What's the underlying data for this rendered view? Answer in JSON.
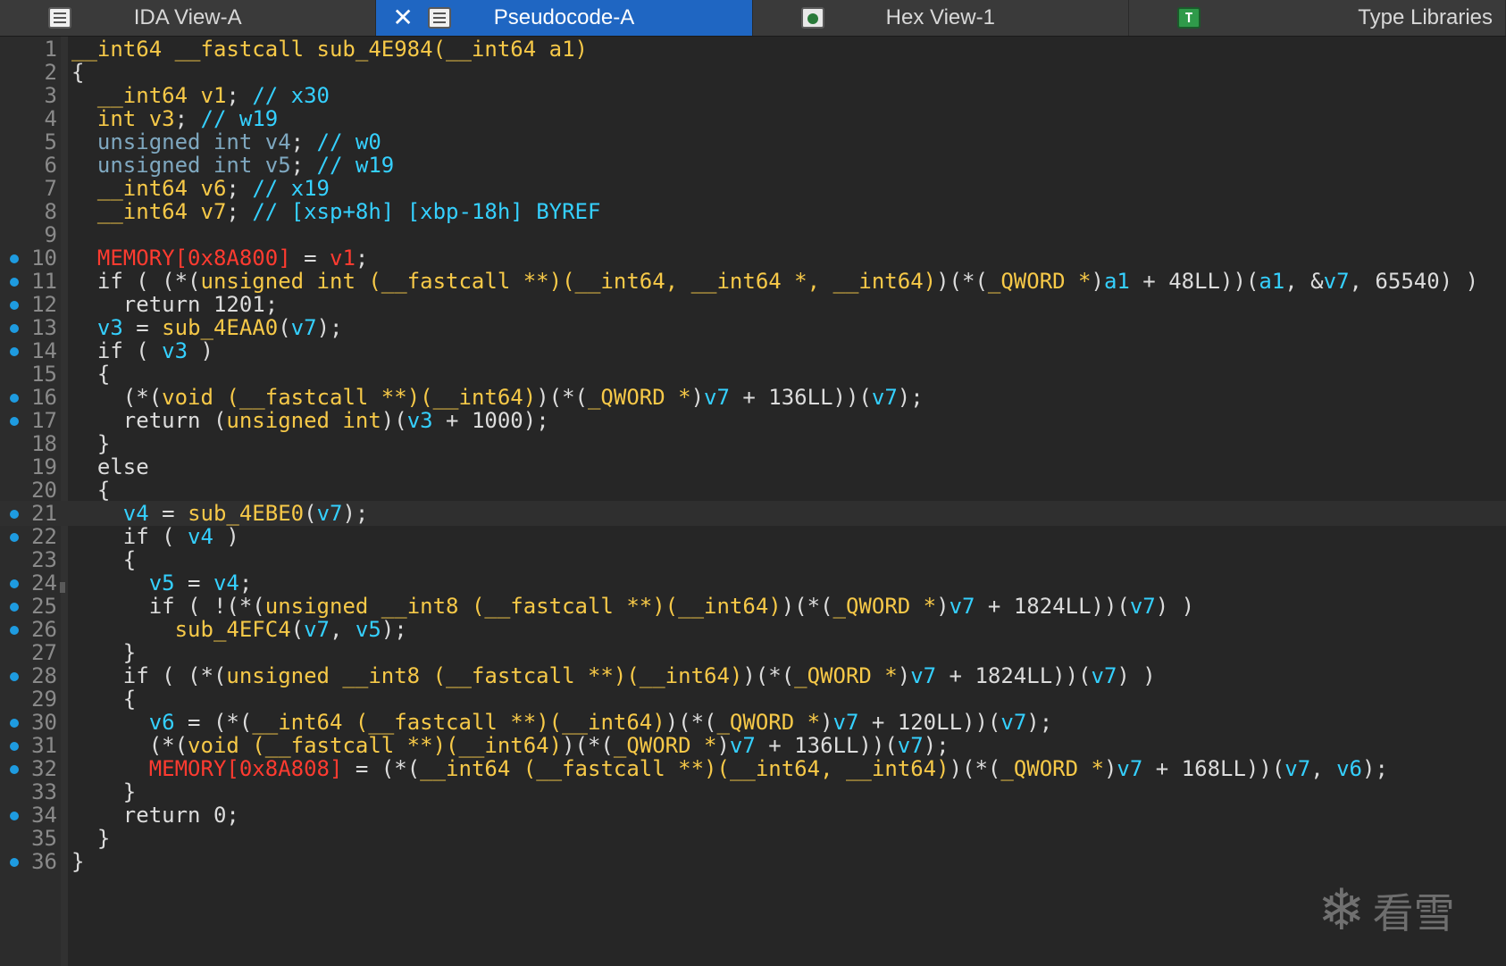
{
  "tabs": [
    {
      "label": "IDA View-A",
      "icon": "list-icon",
      "active": false
    },
    {
      "label": "Pseudocode-A",
      "icon": "list-icon",
      "active": true,
      "close": "✕"
    },
    {
      "label": "Hex View-1",
      "icon": "hex-icon",
      "active": false
    },
    {
      "label": "Type Libraries",
      "icon": "type-library-icon",
      "active": false,
      "icon_text": "T"
    }
  ],
  "code_lines": [
    {
      "n": "1",
      "bp": false
    },
    {
      "n": "2",
      "bp": false
    },
    {
      "n": "3",
      "bp": false
    },
    {
      "n": "4",
      "bp": false
    },
    {
      "n": "5",
      "bp": false
    },
    {
      "n": "6",
      "bp": false
    },
    {
      "n": "7",
      "bp": false
    },
    {
      "n": "8",
      "bp": false
    },
    {
      "n": "9",
      "bp": false
    },
    {
      "n": "10",
      "bp": true
    },
    {
      "n": "11",
      "bp": true
    },
    {
      "n": "12",
      "bp": true
    },
    {
      "n": "13",
      "bp": true
    },
    {
      "n": "14",
      "bp": true
    },
    {
      "n": "15",
      "bp": false
    },
    {
      "n": "16",
      "bp": true
    },
    {
      "n": "17",
      "bp": true
    },
    {
      "n": "18",
      "bp": false
    },
    {
      "n": "19",
      "bp": false
    },
    {
      "n": "20",
      "bp": false
    },
    {
      "n": "21",
      "bp": true
    },
    {
      "n": "22",
      "bp": true
    },
    {
      "n": "23",
      "bp": false
    },
    {
      "n": "24",
      "bp": true
    },
    {
      "n": "25",
      "bp": true
    },
    {
      "n": "26",
      "bp": true
    },
    {
      "n": "27",
      "bp": false
    },
    {
      "n": "28",
      "bp": true
    },
    {
      "n": "29",
      "bp": false
    },
    {
      "n": "30",
      "bp": true
    },
    {
      "n": "31",
      "bp": true
    },
    {
      "n": "32",
      "bp": true
    },
    {
      "n": "33",
      "bp": false
    },
    {
      "n": "34",
      "bp": true
    },
    {
      "n": "35",
      "bp": false
    },
    {
      "n": "36",
      "bp": true
    }
  ],
  "code": {
    "l1": [
      {
        "t": "__int64 __fastcall sub_4E984(__int64 a1)",
        "c": "ty"
      }
    ],
    "l2": [
      {
        "t": "{",
        "c": "kw"
      }
    ],
    "l3": [
      {
        "t": "  ",
        "c": "kw"
      },
      {
        "t": "__int64 v1",
        "c": "ty"
      },
      {
        "t": "; ",
        "c": "kw"
      },
      {
        "t": "// x30",
        "c": "c"
      }
    ],
    "l4": [
      {
        "t": "  ",
        "c": "kw"
      },
      {
        "t": "int v3",
        "c": "ty"
      },
      {
        "t": "; ",
        "c": "kw"
      },
      {
        "t": "// w19",
        "c": "c"
      }
    ],
    "l5": [
      {
        "t": "  unsigned int v4",
        "c": "gray"
      },
      {
        "t": "; ",
        "c": "kw"
      },
      {
        "t": "// w0",
        "c": "c"
      }
    ],
    "l6": [
      {
        "t": "  unsigned int v5",
        "c": "gray"
      },
      {
        "t": "; ",
        "c": "kw"
      },
      {
        "t": "// w19",
        "c": "c"
      }
    ],
    "l7": [
      {
        "t": "  ",
        "c": "kw"
      },
      {
        "t": "__int64 v6",
        "c": "ty"
      },
      {
        "t": "; ",
        "c": "kw"
      },
      {
        "t": "// x19",
        "c": "c"
      }
    ],
    "l8": [
      {
        "t": "  ",
        "c": "kw"
      },
      {
        "t": "__int64 v7",
        "c": "ty"
      },
      {
        "t": "; ",
        "c": "kw"
      },
      {
        "t": "// [xsp+8h] [xbp-18h] BYREF",
        "c": "c"
      }
    ],
    "l9": [
      {
        "t": "",
        "c": "kw"
      }
    ],
    "l10": [
      {
        "t": "  ",
        "c": "kw"
      },
      {
        "t": "MEMORY[0x8A800]",
        "c": "m"
      },
      {
        "t": " = ",
        "c": "kw"
      },
      {
        "t": "v1",
        "c": "m"
      },
      {
        "t": ";",
        "c": "kw"
      }
    ],
    "l11": [
      {
        "t": "  if ( (*(",
        "c": "kw"
      },
      {
        "t": "unsigned int (__fastcall **)(__int64, __int64 *, __int64)",
        "c": "ty"
      },
      {
        "t": ")(*(",
        "c": "kw"
      },
      {
        "t": "_QWORD *",
        "c": "ty"
      },
      {
        "t": ")",
        "c": "kw"
      },
      {
        "t": "a1",
        "c": "v"
      },
      {
        "t": " + 48LL))(",
        "c": "kw"
      },
      {
        "t": "a1",
        "c": "v"
      },
      {
        "t": ", &",
        "c": "kw"
      },
      {
        "t": "v7",
        "c": "v"
      },
      {
        "t": ", 65540) )",
        "c": "kw"
      }
    ],
    "l12": [
      {
        "t": "    return 1201;",
        "c": "kw"
      }
    ],
    "l13": [
      {
        "t": "  ",
        "c": "kw"
      },
      {
        "t": "v3",
        "c": "v"
      },
      {
        "t": " = ",
        "c": "kw"
      },
      {
        "t": "sub_4EAA0",
        "c": "f"
      },
      {
        "t": "(",
        "c": "kw"
      },
      {
        "t": "v7",
        "c": "v"
      },
      {
        "t": ");",
        "c": "kw"
      }
    ],
    "l14": [
      {
        "t": "  if ( ",
        "c": "kw"
      },
      {
        "t": "v3",
        "c": "v"
      },
      {
        "t": " )",
        "c": "kw"
      }
    ],
    "l15": [
      {
        "t": "  {",
        "c": "kw"
      }
    ],
    "l16": [
      {
        "t": "    (*(",
        "c": "kw"
      },
      {
        "t": "void (__fastcall **)(__int64)",
        "c": "ty"
      },
      {
        "t": ")(*(",
        "c": "kw"
      },
      {
        "t": "_QWORD *",
        "c": "ty"
      },
      {
        "t": ")",
        "c": "kw"
      },
      {
        "t": "v7",
        "c": "v"
      },
      {
        "t": " + 136LL))(",
        "c": "kw"
      },
      {
        "t": "v7",
        "c": "v"
      },
      {
        "t": ");",
        "c": "kw"
      }
    ],
    "l17": [
      {
        "t": "    return (",
        "c": "kw"
      },
      {
        "t": "unsigned int",
        "c": "ty"
      },
      {
        "t": ")(",
        "c": "kw"
      },
      {
        "t": "v3",
        "c": "v"
      },
      {
        "t": " + 1000);",
        "c": "kw"
      }
    ],
    "l18": [
      {
        "t": "  }",
        "c": "kw"
      }
    ],
    "l19": [
      {
        "t": "  else",
        "c": "kw"
      }
    ],
    "l20": [
      {
        "t": "  {",
        "c": "kw"
      }
    ],
    "l21": [
      {
        "t": "    ",
        "c": "kw"
      },
      {
        "t": "v4",
        "c": "v"
      },
      {
        "t": " = ",
        "c": "kw"
      },
      {
        "t": "sub_4EBE0",
        "c": "f"
      },
      {
        "t": "(",
        "c": "kw"
      },
      {
        "t": "v7",
        "c": "v"
      },
      {
        "t": ");",
        "c": "kw"
      }
    ],
    "l22": [
      {
        "t": "    if ( ",
        "c": "kw"
      },
      {
        "t": "v4",
        "c": "v"
      },
      {
        "t": " )",
        "c": "kw"
      }
    ],
    "l23": [
      {
        "t": "    {",
        "c": "kw"
      }
    ],
    "l24": [
      {
        "t": "      ",
        "c": "kw"
      },
      {
        "t": "v5",
        "c": "v"
      },
      {
        "t": " = ",
        "c": "kw"
      },
      {
        "t": "v4",
        "c": "v"
      },
      {
        "t": ";",
        "c": "kw"
      }
    ],
    "l25": [
      {
        "t": "      if ( !(*(",
        "c": "kw"
      },
      {
        "t": "unsigned __int8 (__fastcall **)(__int64)",
        "c": "ty"
      },
      {
        "t": ")(*(",
        "c": "kw"
      },
      {
        "t": "_QWORD *",
        "c": "ty"
      },
      {
        "t": ")",
        "c": "kw"
      },
      {
        "t": "v7",
        "c": "v"
      },
      {
        "t": " + 1824LL))(",
        "c": "kw"
      },
      {
        "t": "v7",
        "c": "v"
      },
      {
        "t": ") )",
        "c": "kw"
      }
    ],
    "l26": [
      {
        "t": "        ",
        "c": "kw"
      },
      {
        "t": "sub_4EFC4",
        "c": "f"
      },
      {
        "t": "(",
        "c": "kw"
      },
      {
        "t": "v7",
        "c": "v"
      },
      {
        "t": ", ",
        "c": "kw"
      },
      {
        "t": "v5",
        "c": "v"
      },
      {
        "t": ");",
        "c": "kw"
      }
    ],
    "l27": [
      {
        "t": "    }",
        "c": "kw"
      }
    ],
    "l28": [
      {
        "t": "    if ( (*(",
        "c": "kw"
      },
      {
        "t": "unsigned __int8 (__fastcall **)(__int64)",
        "c": "ty"
      },
      {
        "t": ")(*(",
        "c": "kw"
      },
      {
        "t": "_QWORD *",
        "c": "ty"
      },
      {
        "t": ")",
        "c": "kw"
      },
      {
        "t": "v7",
        "c": "v"
      },
      {
        "t": " + 1824LL))(",
        "c": "kw"
      },
      {
        "t": "v7",
        "c": "v"
      },
      {
        "t": ") )",
        "c": "kw"
      }
    ],
    "l29": [
      {
        "t": "    {",
        "c": "kw"
      }
    ],
    "l30": [
      {
        "t": "      ",
        "c": "kw"
      },
      {
        "t": "v6",
        "c": "v"
      },
      {
        "t": " = (*(",
        "c": "kw"
      },
      {
        "t": "__int64 (__fastcall **)(__int64)",
        "c": "ty"
      },
      {
        "t": ")(*(",
        "c": "kw"
      },
      {
        "t": "_QWORD *",
        "c": "ty"
      },
      {
        "t": ")",
        "c": "kw"
      },
      {
        "t": "v7",
        "c": "v"
      },
      {
        "t": " + 120LL))(",
        "c": "kw"
      },
      {
        "t": "v7",
        "c": "v"
      },
      {
        "t": ");",
        "c": "kw"
      }
    ],
    "l31": [
      {
        "t": "      (*(",
        "c": "kw"
      },
      {
        "t": "void (__fastcall **)(__int64)",
        "c": "ty"
      },
      {
        "t": ")(*(",
        "c": "kw"
      },
      {
        "t": "_QWORD *",
        "c": "ty"
      },
      {
        "t": ")",
        "c": "kw"
      },
      {
        "t": "v7",
        "c": "v"
      },
      {
        "t": " + 136LL))(",
        "c": "kw"
      },
      {
        "t": "v7",
        "c": "v"
      },
      {
        "t": ");",
        "c": "kw"
      }
    ],
    "l32": [
      {
        "t": "      ",
        "c": "kw"
      },
      {
        "t": "MEMORY[0x8A808]",
        "c": "m"
      },
      {
        "t": " = (*(",
        "c": "kw"
      },
      {
        "t": "__int64 (__fastcall **)(__int64, __int64)",
        "c": "ty"
      },
      {
        "t": ")(*(",
        "c": "kw"
      },
      {
        "t": "_QWORD *",
        "c": "ty"
      },
      {
        "t": ")",
        "c": "kw"
      },
      {
        "t": "v7",
        "c": "v"
      },
      {
        "t": " + 168LL))(",
        "c": "kw"
      },
      {
        "t": "v7",
        "c": "v"
      },
      {
        "t": ", ",
        "c": "kw"
      },
      {
        "t": "v6",
        "c": "v"
      },
      {
        "t": ");",
        "c": "kw"
      }
    ],
    "l33": [
      {
        "t": "    }",
        "c": "kw"
      }
    ],
    "l34": [
      {
        "t": "    return 0;",
        "c": "kw"
      }
    ],
    "l35": [
      {
        "t": "  }",
        "c": "kw"
      }
    ],
    "l36": [
      {
        "t": "}",
        "c": "kw"
      }
    ]
  },
  "current_line": "21",
  "watermark": {
    "text": "看雪",
    "icon": "snowflake-icon",
    "glyph": "❄"
  }
}
